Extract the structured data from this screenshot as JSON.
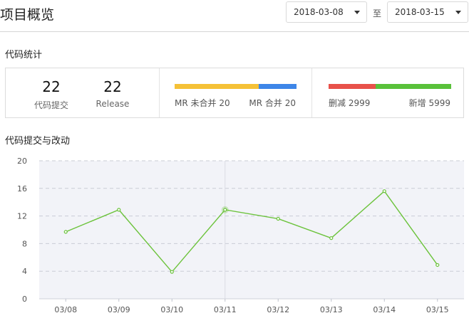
{
  "header": {
    "title": "项目概览",
    "start_date": "2018-03-08",
    "end_date": "2018-03-15",
    "range_separator": "至"
  },
  "code_stats": {
    "section_title": "代码统计",
    "commits": {
      "value": "22",
      "label": "代码提交"
    },
    "releases": {
      "value": "22",
      "label": "Release"
    },
    "merge_requests": {
      "unmerged_label": "MR 未合并",
      "unmerged_value": "20",
      "merged_label": "MR 合并",
      "merged_value": "20",
      "unmerged_color": "#f5c137",
      "merged_color": "#3e86e8"
    },
    "line_changes": {
      "deleted_label": "删减",
      "deleted_value": "2999",
      "added_label": "新增",
      "added_value": "5999",
      "deleted_color": "#e8514a",
      "added_color": "#59c13b"
    }
  },
  "commits_section": {
    "title": "代码提交与改动"
  },
  "chart_data": {
    "type": "line",
    "categories": [
      "03/08",
      "03/09",
      "03/10",
      "03/11",
      "03/12",
      "03/13",
      "03/14",
      "03/15"
    ],
    "series": [
      {
        "values": [
          9.7,
          12.9,
          3.9,
          12.9,
          11.6,
          8.8,
          15.6,
          4.9
        ],
        "color": "#6cc33c"
      }
    ],
    "ylim": [
      0,
      20
    ],
    "yticks": [
      "0",
      "4",
      "8",
      "12",
      "16",
      "20"
    ],
    "highlight_category": "03/11",
    "grid": true,
    "plot_background": "#f2f3f8"
  }
}
